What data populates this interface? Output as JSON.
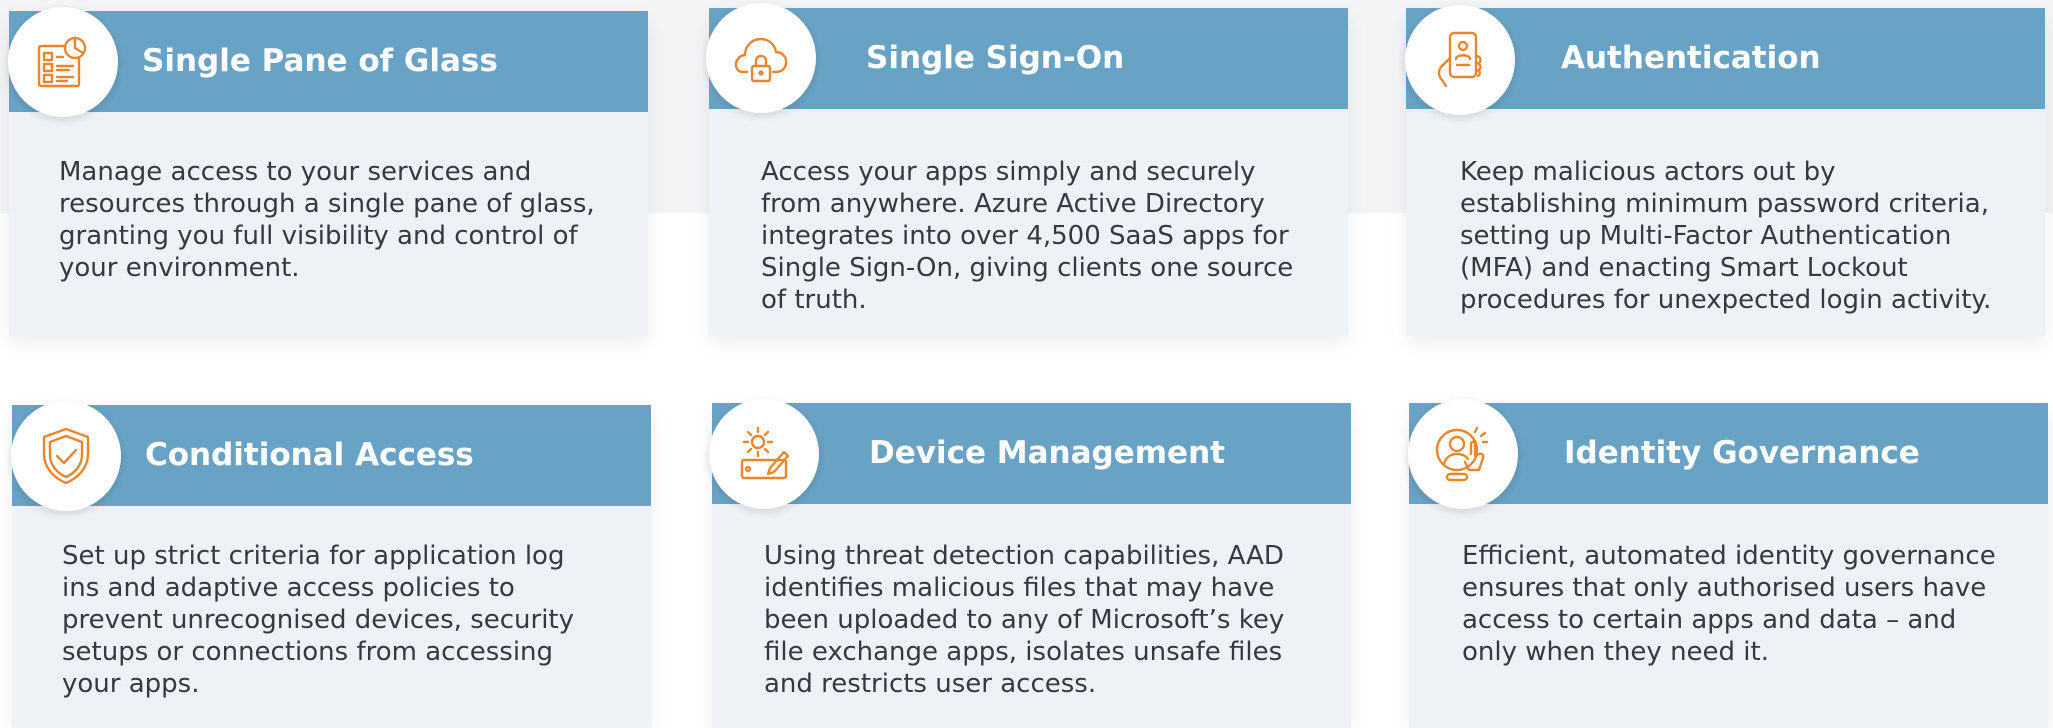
{
  "cards": [
    {
      "title": "Single Pane of Glass",
      "icon": "dashboard-icon",
      "body": "Manage access to your services and resources through a single pane of glass, granting you full visibility and control of your environment."
    },
    {
      "title": "Single Sign-On",
      "icon": "cloud-lock-icon",
      "body": "Access your apps simply and securely from anywhere. Azure Active Directory integrates into over 4,500 SaaS apps for Single Sign-On, giving clients one source of truth."
    },
    {
      "title": "Authentication",
      "icon": "phone-touch-icon",
      "body": "Keep malicious actors out by establishing minimum password criteria, setting up Multi-Factor Authentication (MFA) and enacting Smart Lockout procedures for unexpected login activity."
    },
    {
      "title": "Conditional Access",
      "icon": "shield-check-icon",
      "body": "Set up strict criteria for application log ins and adaptive access policies to prevent unrecognised devices, security setups or connections from accessing your apps."
    },
    {
      "title": "Device Management",
      "icon": "gear-device-icon",
      "body": "Using threat detection capabilities, AAD identifies malicious files that may have been uploaded to any of Microsoft’s key file exchange apps, isolates unsafe files and restricts user access."
    },
    {
      "title": "Identity Governance",
      "icon": "user-touch-icon",
      "body": "Efficient, automated identity governance ensures that only authorised users have access to certain apps and data – and only when they need it."
    }
  ],
  "colors": {
    "header": "#68a2c4",
    "card_bg": "#eef1f6",
    "icon": "#e8862c",
    "text": "#333a40"
  }
}
